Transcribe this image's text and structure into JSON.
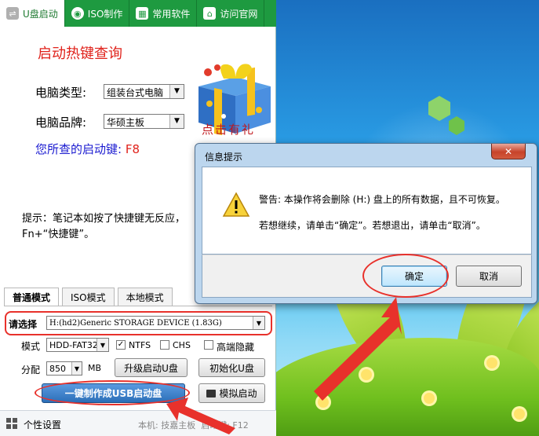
{
  "tabs": [
    {
      "label": "U盘启动",
      "icon": "usb-icon",
      "active": true
    },
    {
      "label": "ISO制作",
      "icon": "disc-icon",
      "active": false
    },
    {
      "label": "常用软件",
      "icon": "grid-icon",
      "active": false
    },
    {
      "label": "访问官网",
      "icon": "home-icon",
      "active": false
    }
  ],
  "hotkey": {
    "title": "启动热键查询",
    "computer_type_label": "电脑类型:",
    "computer_type_value": "组装台式电脑",
    "brand_label": "电脑品牌:",
    "brand_value": "华硕主板",
    "result_label": "您所查的启动键:",
    "result_key": "F8",
    "gift_text": "点击有礼",
    "tip_line1": "提示：笔记本如按了快捷键无反应，",
    "tip_line2": "Fn+“快捷键”。"
  },
  "mode_tabs": [
    "普通模式",
    "ISO模式",
    "本地模式"
  ],
  "normal_mode": {
    "device_label": "请选择",
    "device_value": "H:(hd2)Generic STORAGE DEVICE (1.83G)",
    "mode_label": "模式",
    "mode_value": "HDD-FAT32",
    "ntfs_label": "NTFS",
    "ntfs_checked": true,
    "chs_label": "CHS",
    "chs_checked": false,
    "hide_label": "高端隐藏",
    "hide_checked": false,
    "alloc_label": "分配",
    "alloc_value": "850",
    "alloc_unit": "MB",
    "upgrade_button": "升级启动U盘",
    "init_button": "初始化U盘",
    "make_button": "一键制作成USB启动盘",
    "simulate_button": "模拟启动"
  },
  "bottom_bar": {
    "personal_label": "个性设置",
    "status_text": "本机: 技嘉主板  启动键: F12"
  },
  "dialog": {
    "title": "信息提示",
    "close_label": "✕",
    "message_line1": "警告: 本操作将会删除 (H:) 盘上的所有数据，且不可恢复。",
    "message_line2": "若想继续，请单击“确定”。若想退出，请单击“取消”。",
    "ok_button": "确定",
    "cancel_button": "取消"
  },
  "colors": {
    "tab_bar": "#1e9a40",
    "title_red": "#e0221b",
    "result_blue": "#1a1ad0",
    "make_button": "#2c6fb8",
    "annotation_red": "#e8312b"
  }
}
